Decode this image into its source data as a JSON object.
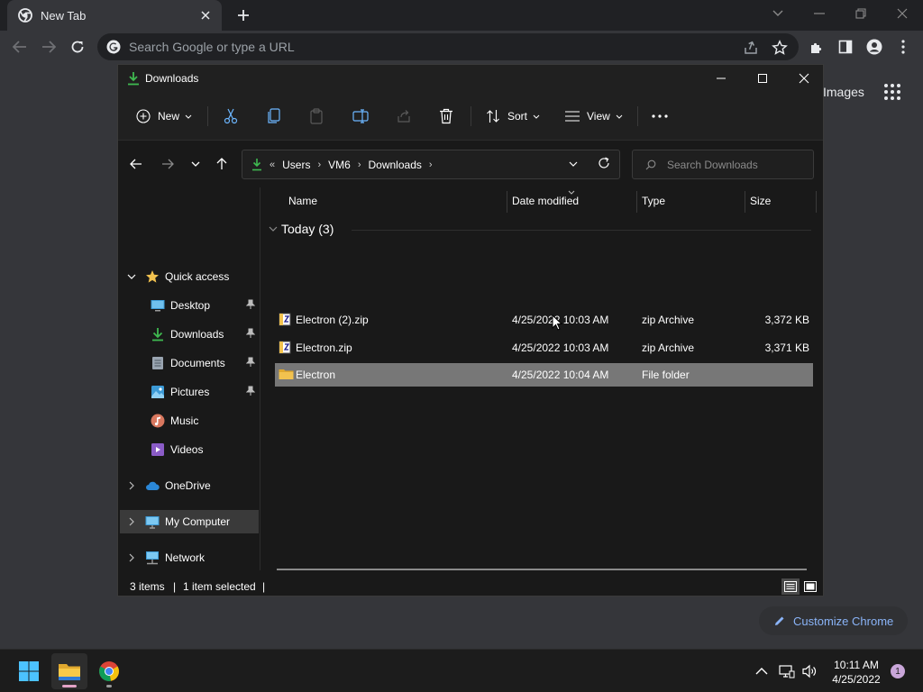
{
  "chrome": {
    "tab_title": "New Tab",
    "omnibox_placeholder": "Search Google or type a URL",
    "ntp_images_link": "Images",
    "customize_button": "Customize Chrome"
  },
  "explorer": {
    "window_title": "Downloads",
    "commands": {
      "new": "New",
      "sort": "Sort",
      "view": "View"
    },
    "address": {
      "overflow": "«",
      "segments": [
        "Users",
        "VM6",
        "Downloads"
      ]
    },
    "search_placeholder": "Search Downloads",
    "nav": {
      "quick_access": "Quick access",
      "items": [
        {
          "label": "Desktop",
          "icon": "desktop-icon",
          "pinned": true
        },
        {
          "label": "Downloads",
          "icon": "download-icon",
          "pinned": true
        },
        {
          "label": "Documents",
          "icon": "document-icon",
          "pinned": true
        },
        {
          "label": "Pictures",
          "icon": "pictures-icon",
          "pinned": true
        },
        {
          "label": "Music",
          "icon": "music-icon",
          "pinned": false
        },
        {
          "label": "Videos",
          "icon": "videos-icon",
          "pinned": false
        }
      ],
      "onedrive": "OneDrive",
      "my_computer": "My Computer",
      "network": "Network"
    },
    "columns": [
      "Name",
      "Date modified",
      "Type",
      "Size"
    ],
    "group_header": "Today (3)",
    "files": [
      {
        "name": "Electron (2).zip",
        "date": "4/25/2022 10:03 AM",
        "type": "zip Archive",
        "size": "3,372 KB",
        "icon": "zip-icon",
        "selected": false
      },
      {
        "name": "Electron.zip",
        "date": "4/25/2022 10:03 AM",
        "type": "zip Archive",
        "size": "3,371 KB",
        "icon": "zip-icon",
        "selected": false
      },
      {
        "name": "Electron",
        "date": "4/25/2022 10:04 AM",
        "type": "File folder",
        "size": "",
        "icon": "folder-icon",
        "selected": true
      }
    ],
    "status": {
      "items": "3 items",
      "selected": "1 item selected",
      "separator": "|"
    }
  },
  "taskbar": {
    "time": "10:11 AM",
    "date": "4/25/2022",
    "notification_count": "1"
  },
  "colors": {
    "accent_green": "#3fb950",
    "folder_yellow": "#f2c24f",
    "selection": "#777777",
    "link_blue": "#8ab4f8"
  }
}
